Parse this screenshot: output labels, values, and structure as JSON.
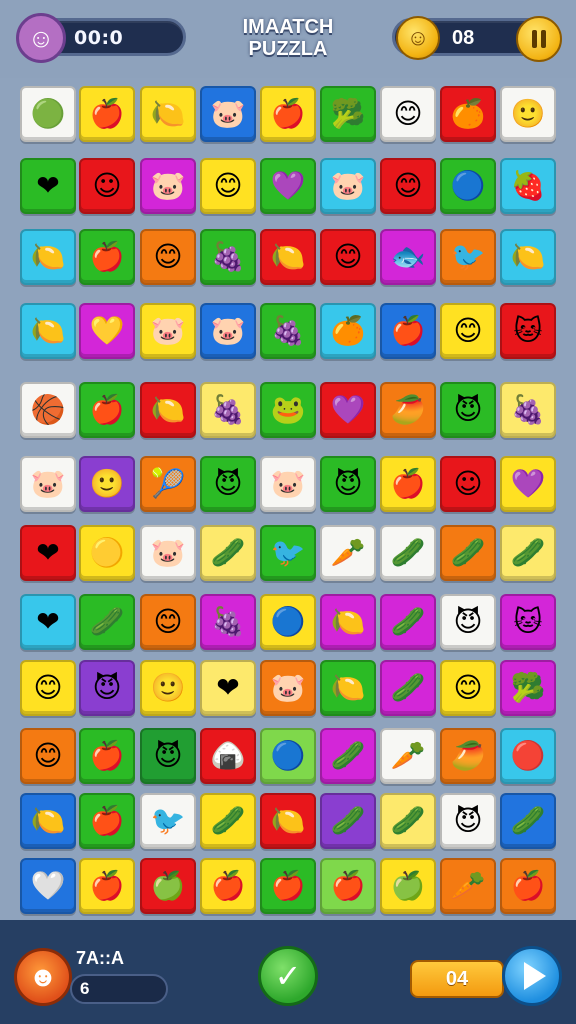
{
  "header": {
    "title": "IMAATCH\nPUZZLA",
    "timer": "00:0",
    "coins": "08",
    "avatar_icon": "player-avatar-icon",
    "coin_icon": "coin-icon",
    "coin_button_icon": "coin-pause-icon"
  },
  "colors": {
    "white": "#f7f7f4",
    "yellow": "#ffe122",
    "lightyellow": "#fde96c",
    "blue": "#2174df",
    "red": "#e8161b",
    "green": "#2bbb25",
    "lightgreen": "#7fd84b",
    "magenta": "#d326d8",
    "orange": "#f47a12",
    "cyan": "#38c7eb",
    "purple": "#8a3ed0",
    "darkgreen": "#219e32"
  },
  "board": {
    "rows": [
      [
        [
          "white",
          "🟢"
        ],
        [
          "yellow",
          "🍎"
        ],
        [
          "yellow",
          "🍋"
        ],
        [
          "blue",
          "🐷"
        ],
        [
          "yellow",
          "🍎"
        ],
        [
          "green",
          "🥦"
        ],
        [
          "white",
          "😊"
        ],
        [
          "red",
          "🍊"
        ],
        [
          "white",
          "🙂"
        ]
      ],
      [
        [
          "green",
          "❤"
        ],
        [
          "red",
          "☺"
        ],
        [
          "magenta",
          "🐷"
        ],
        [
          "yellow",
          "😊"
        ],
        [
          "green",
          "💜"
        ],
        [
          "cyan",
          "🐷"
        ],
        [
          "red",
          "😊"
        ],
        [
          "green",
          "🔵"
        ],
        [
          "cyan",
          "🍓"
        ]
      ],
      [
        [
          "cyan",
          "🍋"
        ],
        [
          "green",
          "🍎"
        ],
        [
          "orange",
          "😊"
        ],
        [
          "green",
          "🍇"
        ],
        [
          "red",
          "🍋"
        ],
        [
          "red",
          "😊"
        ],
        [
          "magenta",
          "🐟"
        ],
        [
          "orange",
          "🐦"
        ],
        [
          "cyan",
          "🍋"
        ]
      ],
      [
        [
          "cyan",
          "🍋"
        ],
        [
          "magenta",
          "💛"
        ],
        [
          "yellow",
          "🐷"
        ],
        [
          "blue",
          "🐷"
        ],
        [
          "green",
          "🍇"
        ],
        [
          "cyan",
          "🍊"
        ],
        [
          "blue",
          "🍎"
        ],
        [
          "yellow",
          "😊"
        ],
        [
          "red",
          "🐱"
        ]
      ],
      [
        [
          "white",
          "🏀"
        ],
        [
          "green",
          "🍎"
        ],
        [
          "red",
          "🍋"
        ],
        [
          "lightyellow",
          "🍇"
        ],
        [
          "green",
          "🐸"
        ],
        [
          "red",
          "💜"
        ],
        [
          "orange",
          "🥭"
        ],
        [
          "green",
          "😈"
        ],
        [
          "lightyellow",
          "🍇"
        ]
      ],
      [
        [
          "white",
          "🐷"
        ],
        [
          "purple",
          "🙂"
        ],
        [
          "orange",
          "🎾"
        ],
        [
          "green",
          "😈"
        ],
        [
          "white",
          "🐷"
        ],
        [
          "green",
          "😈"
        ],
        [
          "yellow",
          "🍎"
        ],
        [
          "red",
          "☺"
        ],
        [
          "yellow",
          "💜"
        ]
      ],
      [
        [
          "red",
          "❤"
        ],
        [
          "yellow",
          "🟡"
        ],
        [
          "white",
          "🐷"
        ],
        [
          "lightyellow",
          "🥒"
        ],
        [
          "green",
          "🐦"
        ],
        [
          "white",
          "🥕"
        ],
        [
          "white",
          "🥒"
        ],
        [
          "orange",
          "🥒"
        ],
        [
          "lightyellow",
          "🥒"
        ]
      ],
      [
        [
          "cyan",
          "❤"
        ],
        [
          "green",
          "🥒"
        ],
        [
          "orange",
          "😊"
        ],
        [
          "magenta",
          "🍇"
        ],
        [
          "yellow",
          "🔵"
        ],
        [
          "magenta",
          "🍋"
        ],
        [
          "magenta",
          "🥒"
        ],
        [
          "white",
          "😈"
        ],
        [
          "magenta",
          "🐱"
        ]
      ],
      [
        [
          "yellow",
          "😊"
        ],
        [
          "purple",
          "😈"
        ],
        [
          "yellow",
          "🙂"
        ],
        [
          "lightyellow",
          "❤"
        ],
        [
          "orange",
          "🐷"
        ],
        [
          "green",
          "🍋"
        ],
        [
          "magenta",
          "🥒"
        ],
        [
          "yellow",
          "😊"
        ],
        [
          "magenta",
          "🥦"
        ]
      ],
      [
        [
          "orange",
          "😊"
        ],
        [
          "green",
          "🍎"
        ],
        [
          "darkgreen",
          "😈"
        ],
        [
          "red",
          "🍙"
        ],
        [
          "lightgreen",
          "🔵"
        ],
        [
          "magenta",
          "🥒"
        ],
        [
          "white",
          "🥕"
        ],
        [
          "orange",
          "🥭"
        ],
        [
          "cyan",
          "🔴"
        ]
      ],
      [
        [
          "blue",
          "🍋"
        ],
        [
          "green",
          "🍎"
        ],
        [
          "white",
          "🐦"
        ],
        [
          "yellow",
          "🥒"
        ],
        [
          "red",
          "🍋"
        ],
        [
          "purple",
          "🥒"
        ],
        [
          "lightyellow",
          "🥒"
        ],
        [
          "white",
          "😈"
        ],
        [
          "blue",
          "🥒"
        ]
      ],
      [
        [
          "blue",
          "🤍"
        ],
        [
          "yellow",
          "🍎"
        ],
        [
          "red",
          "🍏"
        ],
        [
          "yellow",
          "🍎"
        ],
        [
          "green",
          "🍎"
        ],
        [
          "lightgreen",
          "🍎"
        ],
        [
          "yellow",
          "🍏"
        ],
        [
          "orange",
          "🥕"
        ],
        [
          "orange",
          "🍎"
        ]
      ]
    ]
  },
  "footer": {
    "stat_label": "7A::A",
    "stat_value": "6",
    "moves": "04",
    "mascot_icon": "mascot-icon",
    "confirm_icon": "checkmark-icon",
    "next_icon": "play-icon"
  }
}
